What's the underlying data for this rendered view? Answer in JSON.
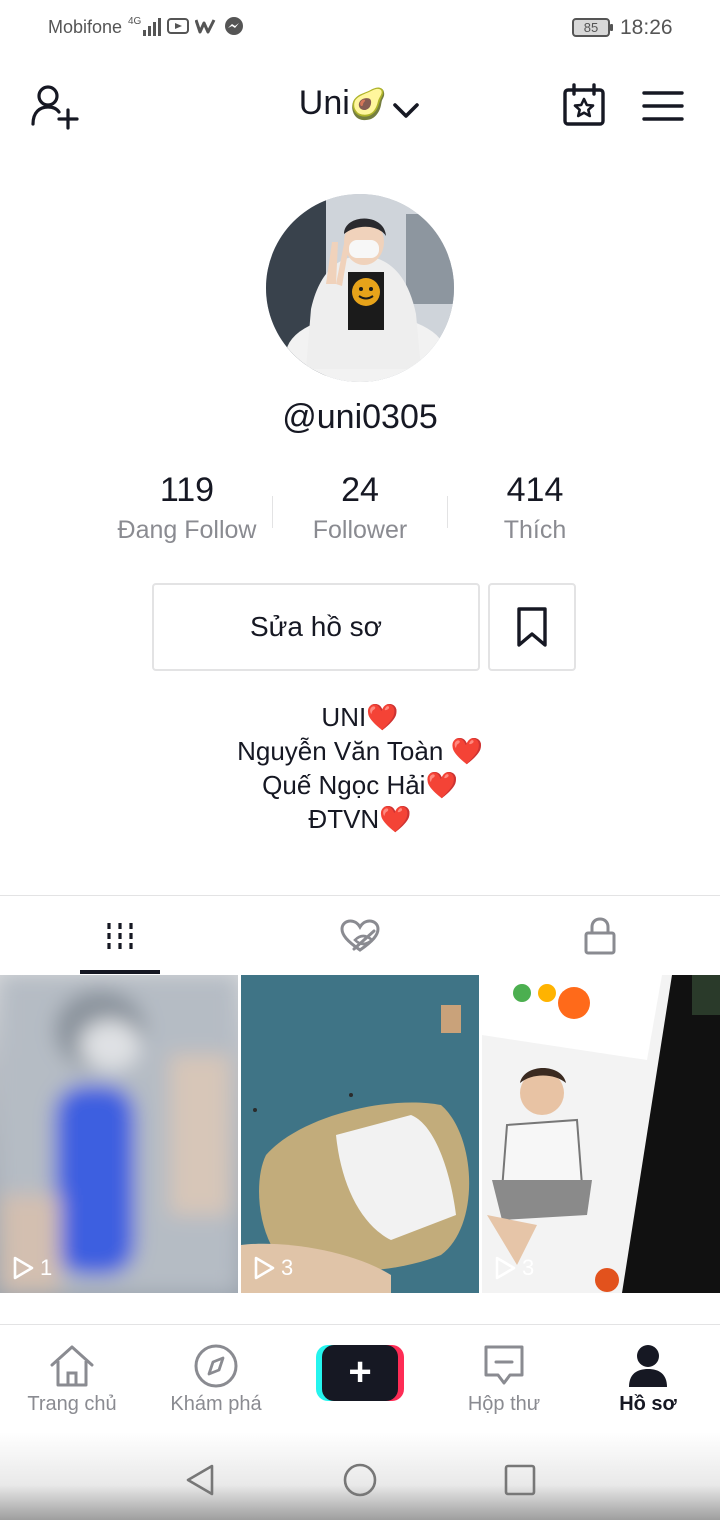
{
  "status_bar": {
    "carrier": "Mobifone",
    "network": "4G",
    "battery": "85",
    "time": "18:26"
  },
  "header": {
    "title": "Uni",
    "title_emoji": "🥑"
  },
  "profile": {
    "username": "@uni0305",
    "stats": [
      {
        "value": "119",
        "label": "Đang Follow"
      },
      {
        "value": "24",
        "label": "Follower"
      },
      {
        "value": "414",
        "label": "Thích"
      }
    ],
    "edit_label": "Sửa hồ sơ",
    "bio": [
      {
        "text": "UNI",
        "heart": "❤️"
      },
      {
        "text": "Nguyễn Văn Toàn ",
        "heart": "❤️"
      },
      {
        "text": "Quế Ngọc Hải",
        "heart": "❤️"
      },
      {
        "text": "ĐTVN",
        "heart": "❤️"
      }
    ]
  },
  "tabs": [
    {
      "name": "videos",
      "icon": "grid-icon",
      "active": true
    },
    {
      "name": "liked",
      "icon": "hidden-heart-icon",
      "active": false
    },
    {
      "name": "private",
      "icon": "lock-icon",
      "active": false
    }
  ],
  "videos": [
    {
      "views": "1"
    },
    {
      "views": "3"
    },
    {
      "views": "3"
    }
  ],
  "bottom_nav": [
    {
      "label": "Trang chủ",
      "icon": "home-icon"
    },
    {
      "label": "Khám phá",
      "icon": "compass-icon"
    },
    {
      "label": "",
      "icon": "create-plus-icon"
    },
    {
      "label": "Hộp thư",
      "icon": "inbox-icon"
    },
    {
      "label": "Hồ sơ",
      "icon": "profile-icon",
      "active": true
    }
  ],
  "colors": {
    "text": "#161823",
    "secondary_text": "#8a8b91",
    "heart": "#e0162b",
    "create_cyan": "#25f4ee",
    "create_pink": "#fe2c55"
  }
}
